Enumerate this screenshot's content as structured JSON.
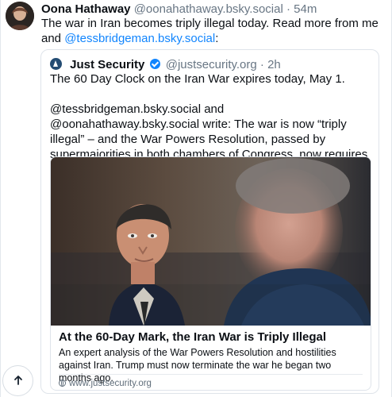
{
  "post": {
    "author_name": "Oona Hathaway",
    "author_handle": "@oonahathaway.bsky.social",
    "separator": "·",
    "time": "54m",
    "text_before_link": "The war in Iran becomes triply illegal today.  Read more from me and ",
    "mention": "@tessbridgeman.bsky.social",
    "text_after_link": ":"
  },
  "quoted_post": {
    "author_name": "Just Security",
    "author_handle": "@justsecurity.org",
    "separator": "·",
    "time": "2h",
    "paragraph_1": "The 60 Day Clock on the Iran War expires today, May 1.",
    "paragraph_2": "@tessbridgeman.bsky.social and @oonahathaway.bsky.social write: The war is now “triply illegal” – and the War Powers Resolution, passed by supermajorities in both chambers of Congress, now requires President Trump to terminate hostilities."
  },
  "link_card": {
    "title": "At the 60-Day Mark, the Iran War is Triply Illegal",
    "description": "An expert analysis of the War Powers Resolution and hostilities against Iran. Trump must now terminate the war he began two months ago.",
    "domain": "www.justsecurity.org"
  },
  "icons": {
    "verified": "verified-check-icon",
    "globe": "globe-icon",
    "scroll_top": "arrow-up-icon"
  },
  "colors": {
    "accent": "#1185fe",
    "muted_text": "#687684",
    "border": "#dfe4ea"
  }
}
